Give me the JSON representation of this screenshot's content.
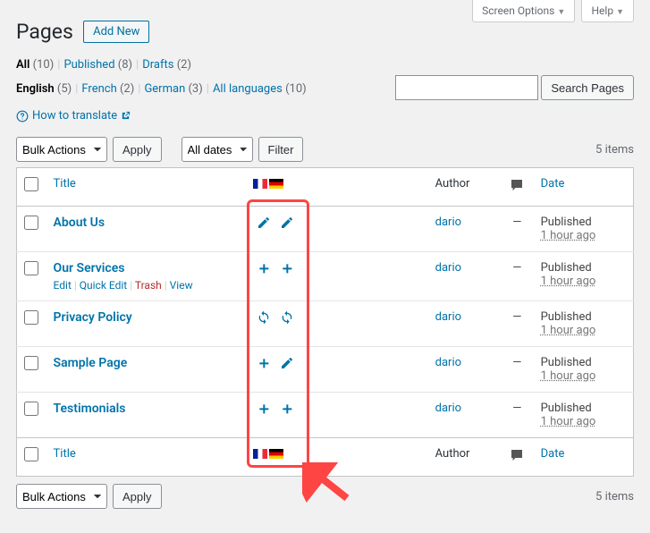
{
  "topTabs": {
    "screenOptions": "Screen Options",
    "help": "Help"
  },
  "header": {
    "title": "Pages",
    "addNew": "Add New"
  },
  "statusFilters": [
    {
      "label": "All",
      "count": 10,
      "current": true,
      "link": false
    },
    {
      "label": "Published",
      "count": 8,
      "link": true
    },
    {
      "label": "Drafts",
      "count": 2,
      "link": true
    }
  ],
  "langFilters": [
    {
      "label": "English",
      "count": 5,
      "link": false,
      "current": true
    },
    {
      "label": "French",
      "count": 2,
      "link": true
    },
    {
      "label": "German",
      "count": 3,
      "link": true
    },
    {
      "label": "All languages",
      "count": 10,
      "link": true
    }
  ],
  "search": {
    "button": "Search Pages",
    "value": ""
  },
  "howTranslate": "How to translate",
  "bulk": {
    "label": "Bulk Actions",
    "apply": "Apply"
  },
  "dateFilter": {
    "label": "All dates",
    "filter": "Filter"
  },
  "itemsLabel": "5 items",
  "columns": {
    "title": "Title",
    "author": "Author",
    "date": "Date"
  },
  "rowActions": {
    "edit": "Edit",
    "quickEdit": "Quick Edit",
    "trash": "Trash",
    "view": "View"
  },
  "flags": [
    "fr",
    "de"
  ],
  "rows": [
    {
      "title": "About Us",
      "author": "dario",
      "status": "Published",
      "ago": "1 hour ago",
      "icons": [
        "pencil",
        "pencil"
      ],
      "showActions": false
    },
    {
      "title": "Our Services",
      "author": "dario",
      "status": "Published",
      "ago": "1 hour ago",
      "icons": [
        "plus",
        "plus"
      ],
      "showActions": true
    },
    {
      "title": "Privacy Policy",
      "author": "dario",
      "status": "Published",
      "ago": "1 hour ago",
      "icons": [
        "sync",
        "sync"
      ],
      "showActions": false
    },
    {
      "title": "Sample Page",
      "author": "dario",
      "status": "Published",
      "ago": "1 hour ago",
      "icons": [
        "plus",
        "pencil"
      ],
      "showActions": false
    },
    {
      "title": "Testimonials",
      "author": "dario",
      "status": "Published",
      "ago": "1 hour ago",
      "icons": [
        "plus",
        "plus"
      ],
      "showActions": false
    }
  ]
}
